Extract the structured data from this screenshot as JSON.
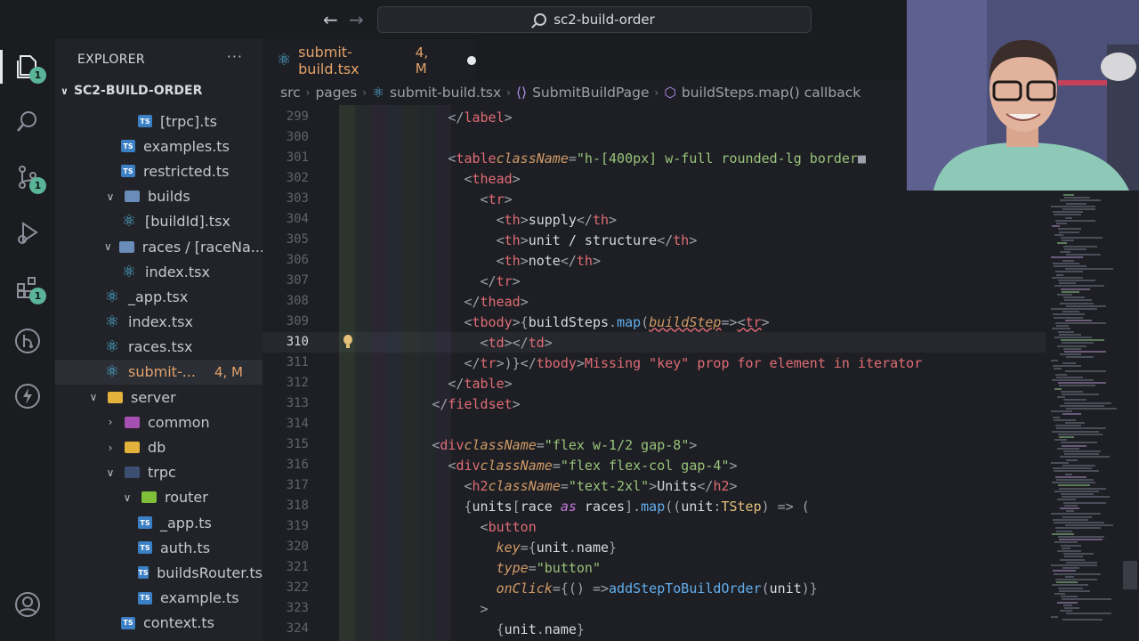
{
  "titlebar": {
    "search_text": "sc2-build-order"
  },
  "activity": {
    "explorer_badge": "1",
    "scm_badge": "1",
    "extensions_badge": "1"
  },
  "sidebar": {
    "title": "EXPLORER",
    "more": "···",
    "root": "SC2-BUILD-ORDER",
    "rows": [
      {
        "label": "[trpc].ts",
        "icon": "ts",
        "indent": 3,
        "chev": ""
      },
      {
        "label": "examples.ts",
        "icon": "ts",
        "indent": 2,
        "chev": ""
      },
      {
        "label": "restricted.ts",
        "icon": "ts",
        "indent": 2,
        "chev": ""
      },
      {
        "label": "builds",
        "icon": "folder",
        "indent": 1,
        "chev": "v"
      },
      {
        "label": "[buildId].tsx",
        "icon": "react",
        "indent": 2,
        "chev": ""
      },
      {
        "label": "races / [raceNa...",
        "icon": "folder",
        "indent": 1,
        "chev": "v"
      },
      {
        "label": "index.tsx",
        "icon": "react",
        "indent": 2,
        "chev": ""
      },
      {
        "label": "_app.tsx",
        "icon": "react",
        "indent": 1,
        "chev": ""
      },
      {
        "label": "index.tsx",
        "icon": "react",
        "indent": 1,
        "chev": ""
      },
      {
        "label": "races.tsx",
        "icon": "react",
        "indent": 1,
        "chev": ""
      },
      {
        "label": "submit-...",
        "icon": "react",
        "indent": 1,
        "chev": "",
        "status": "4, M",
        "selected": true
      },
      {
        "label": "server",
        "icon": "folder-server",
        "indent": 0,
        "chev": "v"
      },
      {
        "label": "common",
        "icon": "folder-common",
        "indent": 1,
        "chev": ">"
      },
      {
        "label": "db",
        "icon": "folder-db",
        "indent": 1,
        "chev": ">"
      },
      {
        "label": "trpc",
        "icon": "folder-trpc",
        "indent": 1,
        "chev": "v"
      },
      {
        "label": "router",
        "icon": "folder-router",
        "indent": 2,
        "chev": "v"
      },
      {
        "label": "_app.ts",
        "icon": "ts",
        "indent": 3,
        "chev": ""
      },
      {
        "label": "auth.ts",
        "icon": "ts",
        "indent": 3,
        "chev": ""
      },
      {
        "label": "buildsRouter.ts",
        "icon": "ts",
        "indent": 3,
        "chev": ""
      },
      {
        "label": "example.ts",
        "icon": "ts",
        "indent": 3,
        "chev": ""
      },
      {
        "label": "context.ts",
        "icon": "ts",
        "indent": 2,
        "chev": ""
      }
    ]
  },
  "tab": {
    "name": "submit-build.tsx",
    "meta": "4, M"
  },
  "breadcrumb": {
    "src": "src",
    "pages": "pages",
    "file": "submit-build.tsx",
    "component": "SubmitBuildPage",
    "callback": "buildSteps.map() callback"
  },
  "editor": {
    "current_line": 310,
    "lines": [
      {
        "n": "299",
        "indent": 7,
        "html": "<span class='punc'>&lt;/</span><span class='tag'>label</span><span class='punc'>&gt;</span>"
      },
      {
        "n": "300",
        "indent": 0,
        "html": ""
      },
      {
        "n": "301",
        "indent": 7,
        "html": "<span class='punc'>&lt;</span><span class='tag'>table</span> <span class='attr'>className</span><span class='punc'>=</span><span class='str'>\"h-[400px] w-full rounded-lg border</span> <span class='punc'>■</span>"
      },
      {
        "n": "302",
        "indent": 8,
        "html": "<span class='punc'>&lt;</span><span class='tag'>thead</span><span class='punc'>&gt;</span>"
      },
      {
        "n": "303",
        "indent": 9,
        "html": "<span class='punc'>&lt;</span><span class='tag'>tr</span><span class='punc'>&gt;</span>"
      },
      {
        "n": "304",
        "indent": 10,
        "html": "<span class='punc'>&lt;</span><span class='tag'>th</span><span class='punc'>&gt;</span>supply<span class='punc'>&lt;/</span><span class='tag'>th</span><span class='punc'>&gt;</span>"
      },
      {
        "n": "305",
        "indent": 10,
        "html": "<span class='punc'>&lt;</span><span class='tag'>th</span><span class='punc'>&gt;</span>unit / structure<span class='punc'>&lt;/</span><span class='tag'>th</span><span class='punc'>&gt;</span>"
      },
      {
        "n": "306",
        "indent": 10,
        "html": "<span class='punc'>&lt;</span><span class='tag'>th</span><span class='punc'>&gt;</span>note<span class='punc'>&lt;/</span><span class='tag'>th</span><span class='punc'>&gt;</span>"
      },
      {
        "n": "307",
        "indent": 9,
        "html": "<span class='punc'>&lt;/</span><span class='tag'>tr</span><span class='punc'>&gt;</span>"
      },
      {
        "n": "308",
        "indent": 8,
        "html": "<span class='punc'>&lt;/</span><span class='tag'>thead</span><span class='punc'>&gt;</span>"
      },
      {
        "n": "309",
        "indent": 8,
        "html": "<span class='punc'>&lt;</span><span class='tag'>tbody</span><span class='punc'>&gt;{</span>buildSteps<span class='punc'>.</span><span class='fn'>map</span><span class='punc'>(</span><span class='attr err'>buildStep</span> <span class='punc'>=&gt;</span> <span class='punc err'>&lt;</span><span class='tag err'>tr</span><span class='punc'>&gt;</span>"
      },
      {
        "n": "310",
        "indent": 9,
        "html": "<span class='punc'>&lt;</span><span class='tag'>td</span><span class='punc'>&gt;&lt;/</span><span class='tag'>td</span><span class='punc'>&gt;</span>"
      },
      {
        "n": "311",
        "indent": 8,
        "html": "<span class='punc'>&lt;/</span><span class='tag'>tr</span><span class='punc'>&gt;)}&lt;/</span><span class='tag'>tbody</span><span class='punc'>&gt;</span>    <span class='lens'>Missing \"key\" prop for element in iterator</span>"
      },
      {
        "n": "312",
        "indent": 7,
        "html": "<span class='punc'>&lt;/</span><span class='tag'>table</span><span class='punc'>&gt;</span>"
      },
      {
        "n": "313",
        "indent": 6,
        "html": "<span class='punc'>&lt;/</span><span class='tag'>fieldset</span><span class='punc'>&gt;</span>"
      },
      {
        "n": "314",
        "indent": 0,
        "html": ""
      },
      {
        "n": "315",
        "indent": 6,
        "html": "<span class='punc'>&lt;</span><span class='tag'>div</span> <span class='attr'>className</span><span class='punc'>=</span><span class='str'>\"flex w-1/2 gap-8\"</span><span class='punc'>&gt;</span>"
      },
      {
        "n": "316",
        "indent": 7,
        "html": "<span class='punc'>&lt;</span><span class='tag'>div</span> <span class='attr'>className</span><span class='punc'>=</span><span class='str'>\"flex flex-col gap-4\"</span><span class='punc'>&gt;</span>"
      },
      {
        "n": "317",
        "indent": 8,
        "html": "<span class='punc'>&lt;</span><span class='tag'>h2</span> <span class='attr'>className</span><span class='punc'>=</span><span class='str'>\"text-2xl\"</span><span class='punc'>&gt;</span>Units<span class='punc'>&lt;/</span><span class='tag'>h2</span><span class='punc'>&gt;</span>"
      },
      {
        "n": "318",
        "indent": 8,
        "html": "<span class='punc'>{</span>units<span class='punc'>[</span>race <span class='kw'>as</span> races<span class='punc'>].</span><span class='fn'>map</span><span class='punc'>((</span>unit<span class='punc'>:</span> <span class='ty'>TStep</span><span class='punc'>) =&gt; (</span>"
      },
      {
        "n": "319",
        "indent": 9,
        "html": "<span class='punc'>&lt;</span><span class='tag'>button</span>"
      },
      {
        "n": "320",
        "indent": 10,
        "html": "<span class='attr'>key</span><span class='punc'>={</span>unit<span class='punc'>.</span>name<span class='punc'>}</span>"
      },
      {
        "n": "321",
        "indent": 10,
        "html": "<span class='attr'>type</span><span class='punc'>=</span><span class='str'>\"button\"</span>"
      },
      {
        "n": "322",
        "indent": 10,
        "html": "<span class='attr'>onClick</span><span class='punc'>={() =&gt;</span> <span class='fn'>addStepToBuildOrder</span><span class='punc'>(</span>unit<span class='punc'>)}</span>"
      },
      {
        "n": "323",
        "indent": 9,
        "html": "<span class='punc'>&gt;</span>"
      },
      {
        "n": "324",
        "indent": 10,
        "html": "<span class='punc'>{</span>unit<span class='punc'>.</span>name<span class='punc'>}</span>"
      }
    ]
  }
}
